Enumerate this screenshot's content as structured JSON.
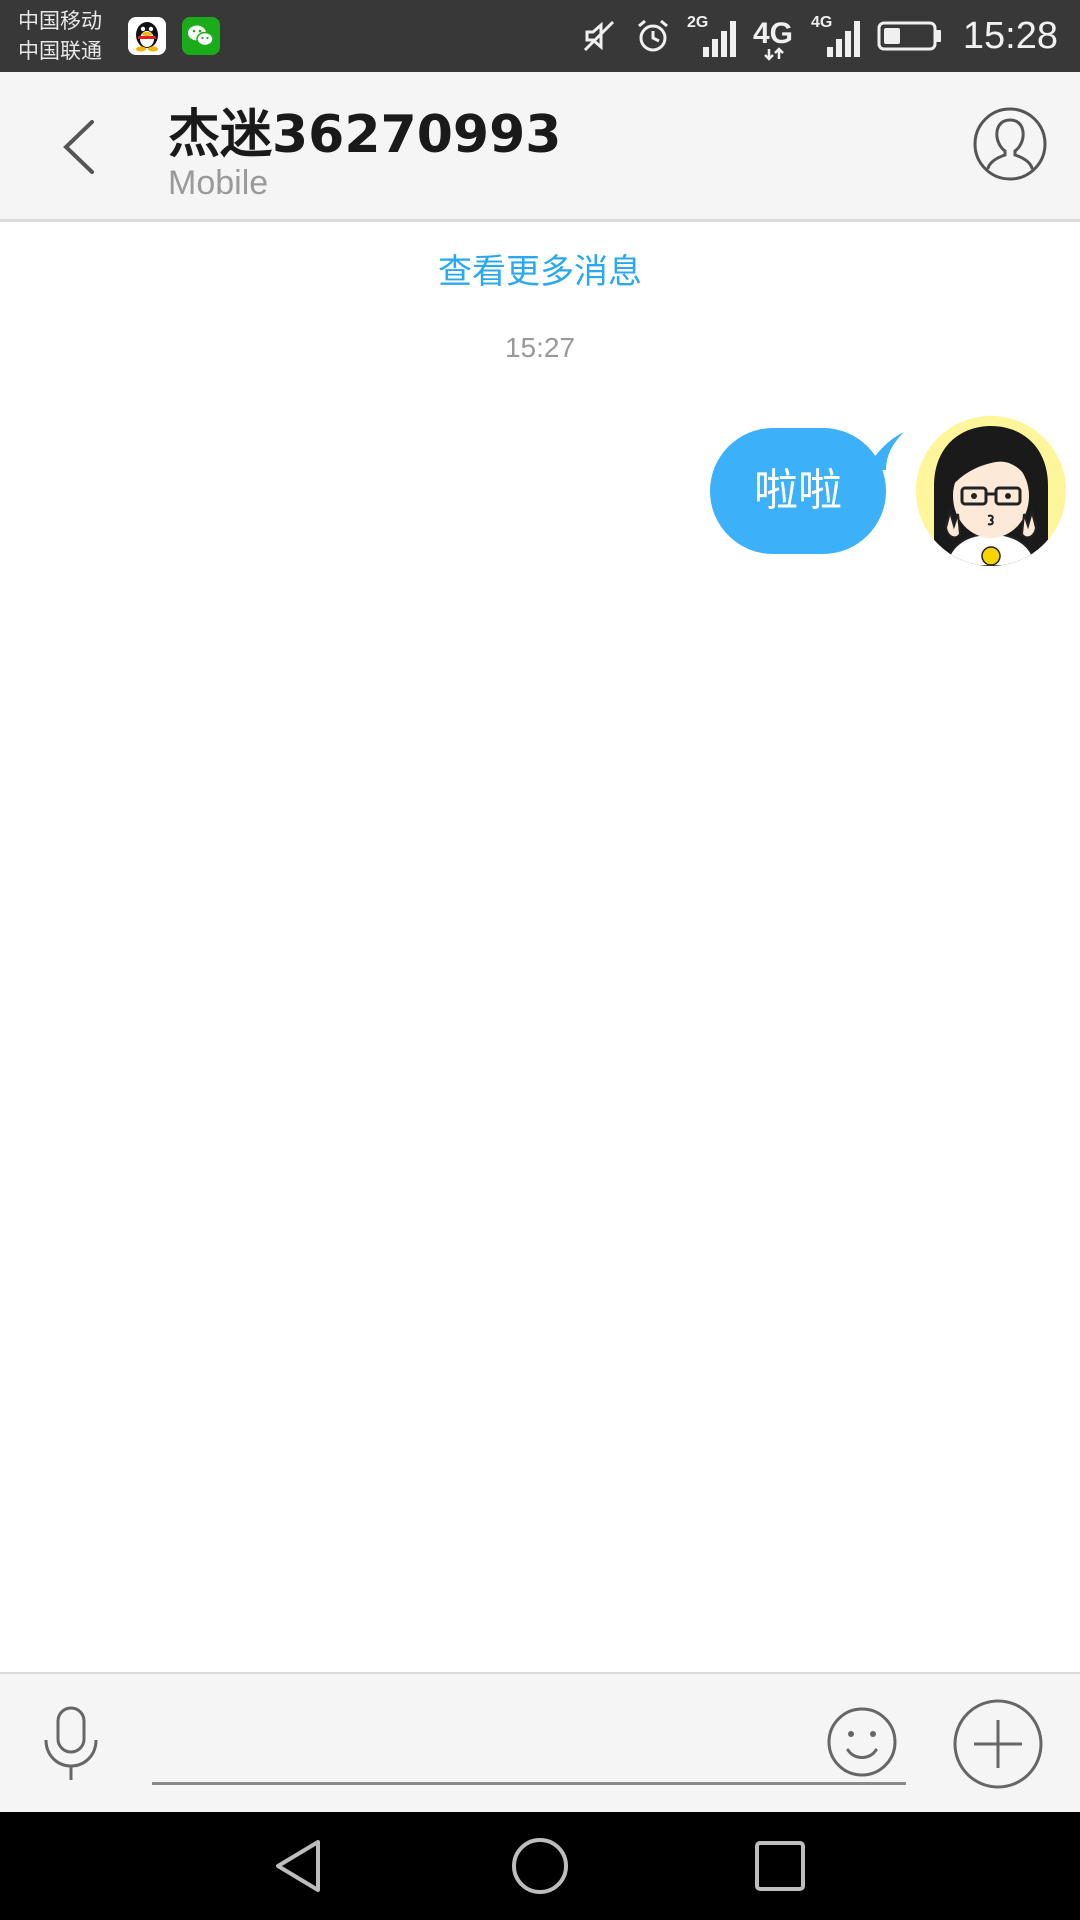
{
  "status_bar": {
    "carrier_1": "中国移动",
    "carrier_2": "中国联通",
    "notification_icons": [
      "qq-icon",
      "wechat-icon"
    ],
    "indicator_icons": [
      "mute-icon",
      "alarm-icon",
      "signal-2g-icon",
      "signal-4g-icon",
      "signal-4g-icon",
      "battery-icon"
    ],
    "network_labels": [
      "2G",
      "4G",
      "4G"
    ],
    "battery_level": 0.35,
    "time": "15:28"
  },
  "header": {
    "back_icon": "chevron-left-icon",
    "title": "杰迷36270993",
    "subtitle": "Mobile",
    "profile_icon": "person-outline-icon"
  },
  "conversation": {
    "load_more_label": "查看更多消息",
    "timestamp": "15:27",
    "messages": [
      {
        "direction": "outgoing",
        "text": "啦啦",
        "avatar": "cartoon-girl-avatar"
      }
    ]
  },
  "input_bar": {
    "voice_icon": "microphone-icon",
    "input_value": "",
    "emoji_icon": "smiley-icon",
    "plus_icon": "plus-circle-icon"
  },
  "nav_bar": {
    "icons": [
      "nav-back-icon",
      "nav-home-icon",
      "nav-recent-icon"
    ]
  },
  "colors": {
    "accent": "#2aa8f0",
    "bubble": "#3cb0f8",
    "status_bar": "#383838",
    "header_bg": "#f5f5f5"
  }
}
